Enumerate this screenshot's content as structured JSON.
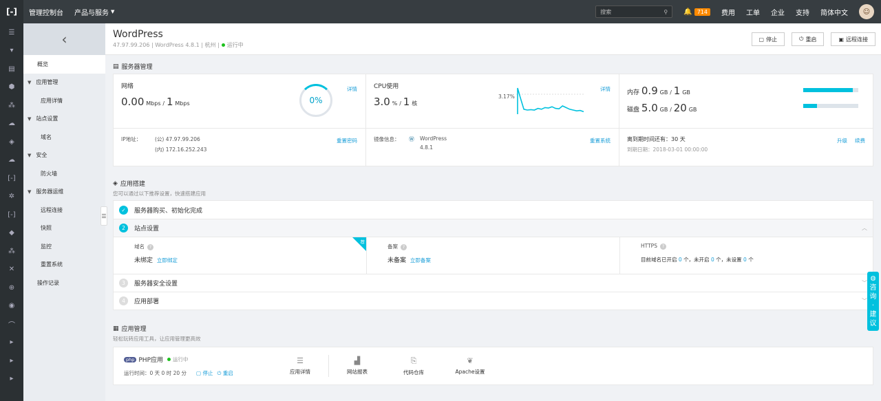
{
  "topbar": {
    "logo": "[-]",
    "console": "管理控制台",
    "products": "产品与服务",
    "search_placeholder": "搜索",
    "notification_count": "714",
    "links": [
      "费用",
      "工单",
      "企业",
      "支持",
      "简体中文"
    ]
  },
  "subnav": {
    "items": [
      {
        "label": "概览",
        "kind": "item",
        "active": true
      },
      {
        "label": "应用管理",
        "kind": "group"
      },
      {
        "label": "应用详情",
        "kind": "sub"
      },
      {
        "label": "站点设置",
        "kind": "group"
      },
      {
        "label": "域名",
        "kind": "sub"
      },
      {
        "label": "安全",
        "kind": "group"
      },
      {
        "label": "防火墙",
        "kind": "sub"
      },
      {
        "label": "服务器运维",
        "kind": "group"
      },
      {
        "label": "远程连接",
        "kind": "sub"
      },
      {
        "label": "快照",
        "kind": "sub"
      },
      {
        "label": "监控",
        "kind": "sub"
      },
      {
        "label": "重置系统",
        "kind": "sub"
      },
      {
        "label": "操作记录",
        "kind": "item"
      }
    ]
  },
  "header": {
    "title": "WordPress",
    "ip": "47.97.99.206",
    "version": "WordPress 4.8.1",
    "region": "杭州",
    "status": "运行中",
    "buttons": {
      "stop": "停止",
      "restart": "重启",
      "remote": "远程连接"
    }
  },
  "server": {
    "section_title": "服务器管理",
    "network": {
      "label": "网络",
      "value": "0.00",
      "unit": "Mbps",
      "sep": "/",
      "limit": "1",
      "limit_unit": "Mbps",
      "percent": "0%",
      "detail": "详情"
    },
    "cpu": {
      "label": "CPU使用",
      "value": "3.0",
      "unit": "%",
      "sep": "/",
      "cores": "1",
      "cores_unit": "核",
      "peak": "3.17%",
      "detail": "详情",
      "series": [
        3.17,
        2.0,
        0.6,
        0.5,
        0.55,
        0.5,
        0.7,
        0.6,
        0.8,
        0.75,
        0.9,
        0.7,
        0.65,
        1.0,
        0.8,
        0.6,
        0.5,
        0.4,
        0.45,
        0.3
      ]
    },
    "memory": {
      "label": "内存",
      "value": "0.9",
      "unit": "GB",
      "sep": "/",
      "total": "1",
      "total_unit": "GB",
      "ratio": 0.9
    },
    "disk": {
      "label": "磁盘",
      "value": "5.0",
      "unit": "GB",
      "sep": "/",
      "total": "20",
      "total_unit": "GB",
      "ratio": 0.25
    },
    "ip": {
      "label": "IP地址：",
      "public": "(公) 47.97.99.206",
      "private": "(内) 172.16.252.243",
      "action": "重置密码"
    },
    "image": {
      "label": "镜像信息：",
      "name": "WordPress",
      "version": "4.8.1",
      "action": "重置系统"
    },
    "expire": {
      "label": "离到期时间还有：30 天",
      "date": "到期日期：2018-03-01 00:00:00",
      "upgrade": "升级",
      "renew": "续费"
    }
  },
  "build": {
    "section_title": "应用搭建",
    "subtitle": "您可以通过以下推荐设置，快速搭建应用",
    "steps": [
      {
        "num": "✓",
        "label": "服务器购买、初始化完成",
        "state": "done"
      },
      {
        "num": "2",
        "label": "站点设置",
        "state": "active"
      },
      {
        "num": "3",
        "label": "服务器安全设置",
        "state": "todo"
      },
      {
        "num": "4",
        "label": "应用部署",
        "state": "todo"
      }
    ],
    "site": {
      "domain": {
        "label": "域名",
        "status": "未绑定",
        "action": "立即绑定"
      },
      "record": {
        "label": "备案",
        "status": "未备案",
        "action": "立即备案"
      },
      "https": {
        "label": "HTTPS",
        "prefix": "目前域名已开启",
        "on": "0",
        "mid1": "个，未开启",
        "off": "0",
        "mid2": "个，未设置",
        "unset": "0",
        "suffix": "个"
      },
      "corner": "荐"
    }
  },
  "apps": {
    "section_title": "应用管理",
    "subtitle": "轻松玩转应用工具，让应用管理更高效",
    "php": {
      "badge": "php",
      "name": "PHP应用",
      "status": "运行中",
      "uptime": "运行时间：0 天 0 时 20 分",
      "stop": "停止",
      "restart": "重启"
    },
    "tools": [
      "应用详情",
      "网站报表",
      "代码仓库",
      "Apache设置"
    ]
  },
  "float_button": [
    "咨",
    "询",
    "·",
    "建",
    "议"
  ]
}
